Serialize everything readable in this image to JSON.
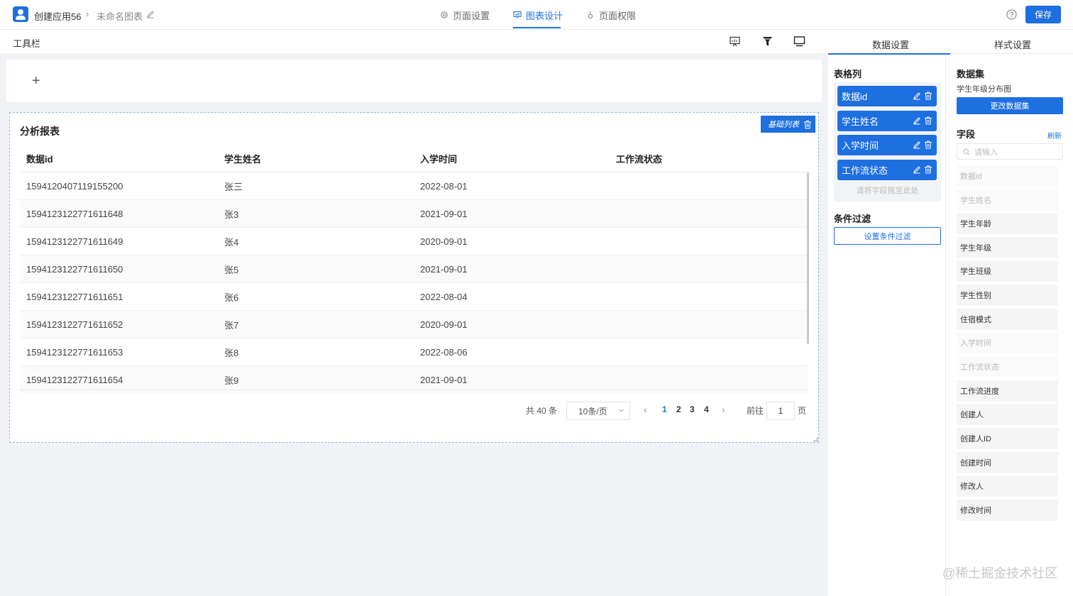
{
  "header": {
    "app_name": "创建应用56",
    "chart_name": "未命名图表",
    "tabs": [
      {
        "label": "页面设置",
        "active": false
      },
      {
        "label": "图表设计",
        "active": true
      },
      {
        "label": "页面权限",
        "active": false
      }
    ],
    "save_label": "保存",
    "accent_color": "#1e6fe0"
  },
  "toolbar": {
    "label": "工具栏",
    "icons": [
      "presentation-icon",
      "filter-icon",
      "monitor-icon"
    ]
  },
  "canvas": {
    "add_label": "+"
  },
  "report": {
    "title": "分析报表",
    "tag": "基础列表",
    "columns": [
      "数据id",
      "学生姓名",
      "入学时间",
      "工作流状态"
    ],
    "rows": [
      [
        "1594120407119155200",
        "张三",
        "2022-08-01",
        ""
      ],
      [
        "1594123122771611648",
        "张3",
        "2021-09-01",
        ""
      ],
      [
        "1594123122771611649",
        "张4",
        "2020-09-01",
        ""
      ],
      [
        "1594123122771611650",
        "张5",
        "2021-09-01",
        ""
      ],
      [
        "1594123122771611651",
        "张6",
        "2022-08-04",
        ""
      ],
      [
        "1594123122771611652",
        "张7",
        "2020-09-01",
        ""
      ],
      [
        "1594123122771611653",
        "张8",
        "2022-08-06",
        ""
      ],
      [
        "1594123122771611654",
        "张9",
        "2021-09-01",
        ""
      ]
    ],
    "pager": {
      "total": "共 40 条",
      "page_size": "10条/页",
      "pages": [
        "1",
        "2",
        "3",
        "4"
      ],
      "current": "1",
      "goto_label": "前往",
      "goto_value": "1",
      "page_suffix": "页"
    }
  },
  "panel": {
    "tabs": [
      "数据设置",
      "样式设置"
    ],
    "columns_title": "表格列",
    "columns": [
      "数据id",
      "学生姓名",
      "入学时间",
      "工作流状态"
    ],
    "drop_hint": "请将字段拖至此处",
    "filter_title": "条件过滤",
    "filter_button": "设置条件过滤",
    "dataset_title": "数据集",
    "dataset_name": "学生年级分布图",
    "change_dataset": "更改数据集",
    "fields_title": "字段",
    "refresh": "刷新",
    "search_placeholder": "请输入",
    "fields": [
      {
        "label": "数据id",
        "disabled": true
      },
      {
        "label": "学生姓名",
        "disabled": true
      },
      {
        "label": "学生年龄",
        "disabled": false
      },
      {
        "label": "学生年级",
        "disabled": false
      },
      {
        "label": "学生班级",
        "disabled": false
      },
      {
        "label": "学生性别",
        "disabled": false
      },
      {
        "label": "住宿模式",
        "disabled": false
      },
      {
        "label": "入学时间",
        "disabled": true
      },
      {
        "label": "工作流状态",
        "disabled": true
      },
      {
        "label": "工作流进度",
        "disabled": false
      },
      {
        "label": "创建人",
        "disabled": false
      },
      {
        "label": "创建人ID",
        "disabled": false
      },
      {
        "label": "创建时间",
        "disabled": false
      },
      {
        "label": "修改人",
        "disabled": false
      },
      {
        "label": "修改时间",
        "disabled": false
      }
    ]
  },
  "watermark": "@稀土掘金技术社区"
}
